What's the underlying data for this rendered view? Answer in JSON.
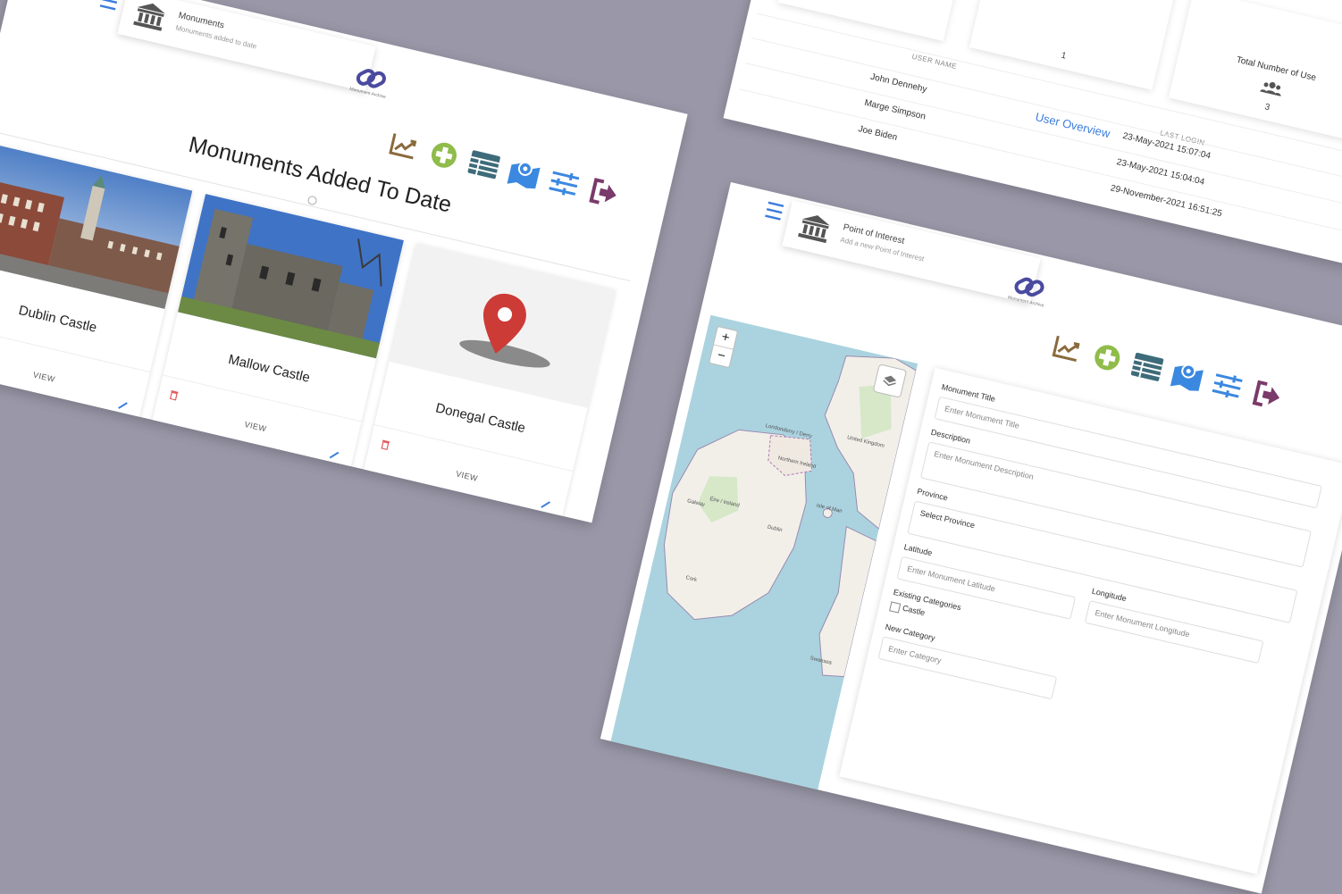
{
  "monuments_page": {
    "header_title": "Monuments",
    "header_subtitle": "Monuments added to date",
    "brand_text": "Monument Archive",
    "page_title": "Monuments Added To Date",
    "cards": [
      {
        "name": "Dublin Castle",
        "view_label": "VIEW"
      },
      {
        "name": "Mallow Castle",
        "view_label": "VIEW"
      },
      {
        "name": "Donegal Castle",
        "view_label": "VIEW"
      }
    ],
    "toolbar_icons": [
      "chart-line-icon",
      "add-circle-icon",
      "table-icon",
      "map-marker-icon",
      "sliders-icon",
      "sign-out-icon"
    ]
  },
  "users_page": {
    "stat_middle_value": "1",
    "stat_users_label": "Total Number of Use",
    "stat_users_value": "3",
    "overview_title": "User Overview",
    "col_username": "USER NAME",
    "col_last_login": "LAST LOGIN",
    "users": [
      {
        "name": "John Dennehy",
        "last_login": "23-May-2021 15:07:04"
      },
      {
        "name": "Marge Simpson",
        "last_login": "23-May-2021 15:04:04"
      },
      {
        "name": "Joe Biden",
        "last_login": "29-November-2021 16:51:25"
      }
    ]
  },
  "poi_page": {
    "header_title": "Point of Interest",
    "header_subtitle": "Add a new Point of Interest",
    "brand_text": "Monument Archive",
    "map": {
      "zoom_in": "+",
      "zoom_out": "−",
      "labels": {
        "londonderry": "Londonderry / Derry",
        "northern_ireland": "Northern Ireland",
        "united_kingdom": "United Kingdom",
        "eire": "Éire / Ireland",
        "galway": "Galway",
        "dublin": "Dublin",
        "isle_of_man": "Isle of Man",
        "cork": "Cork",
        "swansea": "Swansea"
      }
    },
    "form": {
      "title_label": "Monument Title",
      "title_placeholder": "Enter Monument Title",
      "description_label": "Description",
      "description_placeholder": "Enter Monument Description",
      "province_label": "Province",
      "province_value": "Select Province",
      "latitude_label": "Latitude",
      "latitude_placeholder": "Enter Monument Latitude",
      "longitude_label": "Longitude",
      "longitude_placeholder": "Enter Monument Longitude",
      "existing_categories_label": "Existing Categories",
      "category_castle": "Castle",
      "new_category_label": "New Category",
      "new_category_placeholder": "Enter Category"
    }
  },
  "colors": {
    "background": "#9a98a8",
    "accent_blue": "#3b7ddd",
    "chart_brown": "#8a6a3c",
    "add_green": "#8fbc4a",
    "table_teal": "#3d6b7a",
    "sliders_blue": "#3b88e0",
    "signout_purple": "#7a3a6a",
    "delete_red": "#e05a5a",
    "marker_red": "#cc3b36"
  }
}
